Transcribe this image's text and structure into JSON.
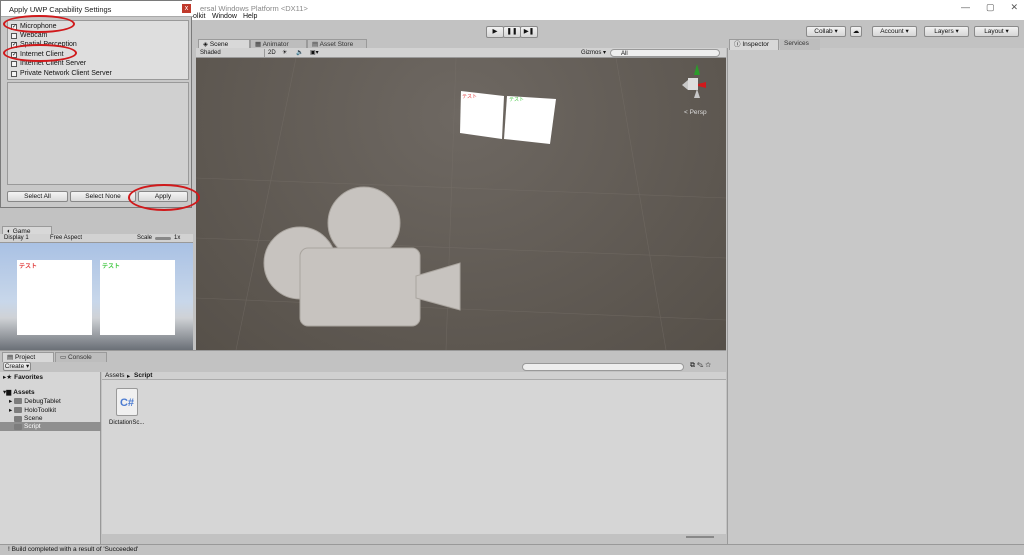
{
  "window": {
    "title": "ersal Windows Platform <DX11>",
    "controls": [
      "—",
      "▢",
      "✕"
    ]
  },
  "menu": [
    "olkit",
    "Window",
    "Help"
  ],
  "toolbar": {
    "collab": "Collab ▾",
    "account": "Account ▾",
    "layers": "Layers",
    "layout": "Layout",
    "play": "▶",
    "pause": "❚❚",
    "step": "▶❚"
  },
  "dialog": {
    "title": "Apply UWP Capability Settings",
    "capabilities": [
      {
        "label": "Microphone",
        "checked": true
      },
      {
        "label": "Webcam",
        "checked": false
      },
      {
        "label": "Spatial Perception",
        "checked": true
      },
      {
        "label": "Internet Client",
        "checked": true
      },
      {
        "label": "Internet Client Server",
        "checked": false
      },
      {
        "label": "Private Network Client Server",
        "checked": false
      }
    ],
    "buttons": {
      "select_all": "Select All",
      "select_none": "Select None",
      "apply": "Apply"
    }
  },
  "scene": {
    "tabs": [
      "Scene",
      "Animator",
      "Asset Store"
    ],
    "shading": "Shaded",
    "mode2d": "2D",
    "gizmos": "Gizmos ▾",
    "search_placeholder": "All",
    "persp": "< Persp",
    "panel_text": "テスト"
  },
  "game": {
    "tab": "Game",
    "display": "Display 1",
    "aspect": "Free Aspect",
    "scale_label": "Scale",
    "scale_value": "1x",
    "card_text": "テスト"
  },
  "project": {
    "tabs": [
      "Project",
      "Console"
    ],
    "create": "Create ▾",
    "favorites": "Favorites",
    "assets": "Assets",
    "folders": [
      "DebugTablet",
      "HoloToolkit",
      "Scene",
      "Script"
    ],
    "breadcrumb_root": "Assets",
    "breadcrumb_sep": "▸",
    "breadcrumb_current": "Script",
    "file": {
      "name": "DictationSc...",
      "icon_text": "C#"
    }
  },
  "inspector": {
    "tabs": [
      "Inspector",
      "Services"
    ]
  },
  "status": {
    "message": "Build completed with a result of 'Succeeded'",
    "icon": "!"
  },
  "colors": {
    "ring": "#d0191b",
    "scene_bg": "#5f5852",
    "red_label": "#e03a3a",
    "green_label": "#3fc73f"
  }
}
